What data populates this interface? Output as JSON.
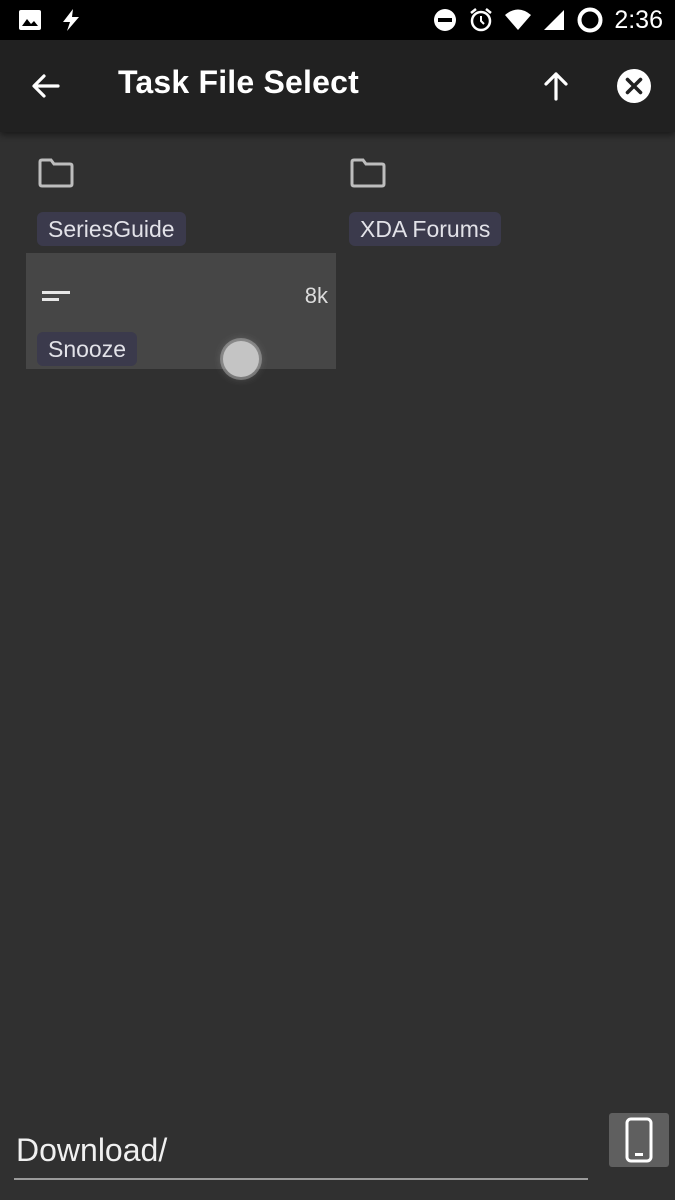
{
  "status_bar": {
    "time": "2:36",
    "left_icons": [
      "image-icon",
      "flash-icon"
    ],
    "right_icons": [
      "do-not-disturb-icon",
      "alarm-icon",
      "wifi-icon",
      "cell-signal-icon",
      "battery-ring-icon"
    ]
  },
  "toolbar": {
    "title": "Task File Select",
    "back_icon": "arrow-back-icon",
    "up_icon": "arrow-up-icon",
    "close_icon": "close-circle-icon"
  },
  "items": [
    {
      "type": "folder",
      "name": "SeriesGuide"
    },
    {
      "type": "folder",
      "name": "XDA Forums"
    },
    {
      "type": "file",
      "name": "Snooze",
      "size": "8k"
    }
  ],
  "path_field": {
    "value": "Download/"
  },
  "device_button": {
    "icon": "phone-icon"
  },
  "colors": {
    "background": "#303030",
    "toolbar": "#212121",
    "status_bar": "#000000",
    "chip": "#3b3a4c",
    "selected_tile": "#464646"
  }
}
